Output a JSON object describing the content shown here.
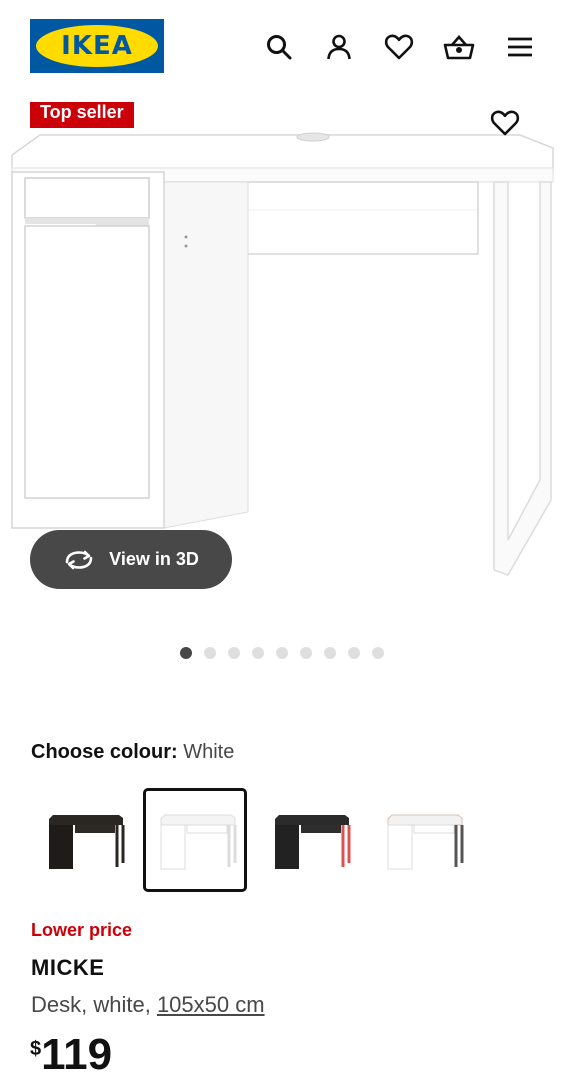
{
  "header": {
    "logo_text": "IKEA",
    "icons": [
      "search-icon",
      "account-icon",
      "heart-icon",
      "basket-icon",
      "menu-icon"
    ]
  },
  "product_image": {
    "badge": "Top seller",
    "favourite_icon": "heart-icon",
    "view3d_label": "View in 3D",
    "view3d_icon": "rotate-icon",
    "carousel": {
      "total": 9,
      "active": 1
    }
  },
  "colour": {
    "label": "Choose colour:",
    "value": "White",
    "swatches": [
      {
        "name": "black-brown",
        "selected": false
      },
      {
        "name": "white",
        "selected": true
      },
      {
        "name": "anthracite-red",
        "selected": false
      },
      {
        "name": "white-anthracite",
        "selected": false
      }
    ]
  },
  "product": {
    "lower_price_label": "Lower price",
    "name": "MICKE",
    "description": "Desk, white, ",
    "dimensions": "105x50 cm",
    "currency": "$",
    "price": "119"
  },
  "colors": {
    "ikea_blue": "#0058a3",
    "ikea_yellow": "#ffdb00",
    "sale_red": "#cc0008",
    "button_dark": "#484848"
  }
}
